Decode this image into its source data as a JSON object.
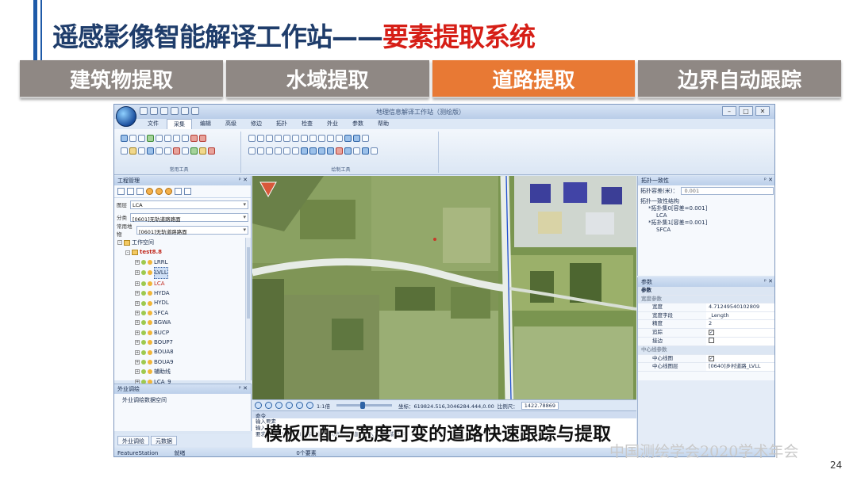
{
  "slide": {
    "title_main": "遥感影像智能解译工作站——",
    "title_highlight": "要素提取系统",
    "tabs": [
      {
        "label": "建筑物提取"
      },
      {
        "label": "水域提取"
      },
      {
        "label": "道路提取",
        "active": true
      },
      {
        "label": "边界自动跟踪"
      }
    ],
    "caption": "模板匹配与宽度可变的道路快速跟踪与提取",
    "watermark": "中国测绘学会2020学术年会",
    "page_number": "24",
    "colors": {
      "title": "#1f3d6b",
      "highlight": "#d61e16",
      "tab": "#8f8884",
      "tab_active": "#e87934"
    }
  },
  "app": {
    "window_title": "地理信息解译工作站（测绘版）",
    "menu": [
      "文件",
      "采集",
      "编辑",
      "高级",
      "修边",
      "拓扑",
      "检查",
      "外业",
      "参数",
      "帮助"
    ],
    "active_menu": "采集",
    "ribbon_groups": [
      "常用工具",
      "绘制工具"
    ],
    "left_panel": {
      "title": "工程管理",
      "fields": [
        {
          "label": "图层",
          "value": "LCA"
        },
        {
          "label": "分类",
          "value": "[0601]无轨道路路面"
        },
        {
          "label": "常用地物",
          "value": "[0601]无轨道路路面"
        }
      ],
      "tree_root": "工作空间",
      "tree_project": "test8.8",
      "layers": [
        "LRRL",
        "LVLL",
        "LCA",
        "HYDA",
        "HYDL",
        "SFCA",
        "BGWA",
        "BUCP",
        "BOUP7",
        "BOUA8",
        "BOUA9",
        "辅助线",
        "LCA_9"
      ],
      "highlighted_layer": "LVLL",
      "red_layer": "LCA"
    },
    "field_panel": {
      "title": "外业调绘",
      "item": "外业调绘数据空间"
    },
    "bottom_tabs": [
      "外业调绘",
      "元数据"
    ],
    "status": {
      "station": "FeatureStation",
      "ready": "就绪",
      "selected": "0个要素"
    },
    "map_toolbar": {
      "scale": "1:1倍",
      "coords": "坐标：619824.516,3046284.444,0.00",
      "scale_label": "比例尺：",
      "scale_value": "1422.78869"
    },
    "command": {
      "title": "命令",
      "lines": [
        "输入要素",
        "输入要素",
        "要求选择(S)加点(A)删除当前点(D)撤销(U)直接输入下一点或放弃"
      ]
    },
    "topology_panel": {
      "title": "拓扑一致性",
      "tolerance_label": "拓扑容差(米)：",
      "tolerance_value": "0.001",
      "structure_label": "拓扑一致性结构",
      "items": [
        {
          "name": "*拓扑集0[容差=0.001]",
          "child": "LCA"
        },
        {
          "name": "*拓扑集1[容差=0.001]",
          "child": "SFCA"
        }
      ]
    },
    "params_panel": {
      "title": "参数",
      "root": "参数",
      "sections": [
        {
          "name": "宽度参数",
          "rows": [
            {
              "k": "宽度",
              "v": "4.71249540102809"
            },
            {
              "k": "宽度字段",
              "v": "_Length"
            },
            {
              "k": "精度",
              "v": "2"
            },
            {
              "k": "追踪",
              "check": true
            },
            {
              "k": "接边",
              "check": false
            }
          ]
        },
        {
          "name": "中心线参数",
          "rows": [
            {
              "k": "中心线图",
              "check": true
            },
            {
              "k": "中心线图层",
              "v": "[0640]乡村道路_LVLL"
            }
          ]
        }
      ]
    }
  }
}
